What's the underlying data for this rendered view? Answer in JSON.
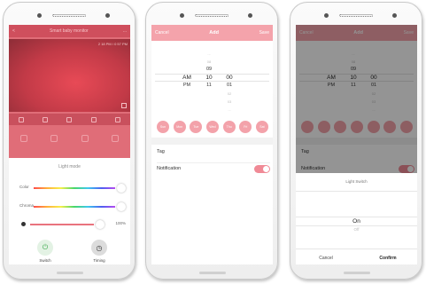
{
  "screen1": {
    "nav_left": "<",
    "nav_title": "Smart baby monitor",
    "nav_right": "...",
    "video_time": "2 18 PM / 0 57 PM",
    "sheet_title": "Light mode",
    "color_label": "Color",
    "chroma_label": "Chroma",
    "brightness_value": "100%",
    "switch_label": "Switch",
    "timing_label": "Timing"
  },
  "screen2": {
    "cancel": "Cancel",
    "title": "Add",
    "save": "Save",
    "ampm": [
      "AM",
      "PM"
    ],
    "hours": [
      "...",
      "08",
      "09",
      "10",
      "11",
      "..."
    ],
    "minutes": [
      "00",
      "01",
      "02",
      "03",
      "..."
    ],
    "days": [
      "Sun",
      "Mon",
      "Tue",
      "Wed",
      "Thu",
      "Fri",
      "Sat"
    ],
    "tag_label": "Tag",
    "notification_label": "Notification",
    "notification_on": true
  },
  "screen3": {
    "cancel": "Cancel",
    "title": "Add",
    "save": "Save",
    "ampm": [
      "AM",
      "PM"
    ],
    "hours": [
      "...",
      "08",
      "09",
      "10",
      "11",
      "..."
    ],
    "minutes": [
      "00",
      "01",
      "02",
      "03",
      "..."
    ],
    "tag_label": "Tag",
    "notification_label": "Notification",
    "popup_title": "Light Switch",
    "popup_selected": "On",
    "popup_next": "Off",
    "popup_cancel": "Cancel",
    "popup_confirm": "Confirm"
  },
  "colors": {
    "accent": "#f4a3ab",
    "toggle_on": "#f08a96",
    "switch_green": "#3aa84a"
  }
}
